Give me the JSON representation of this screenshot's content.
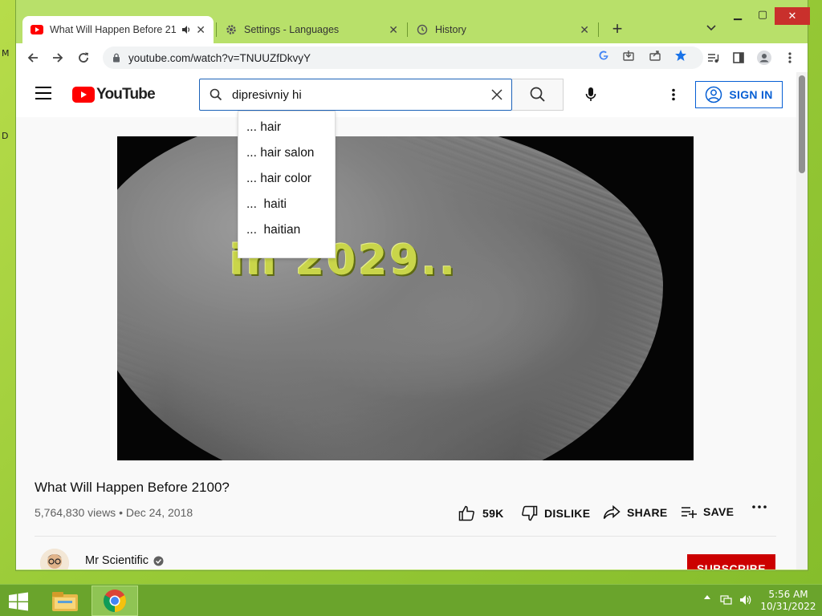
{
  "desktop": {
    "edge_labels": [
      "M",
      "D"
    ]
  },
  "browser": {
    "tabs": [
      {
        "title": "What Will Happen Before 21",
        "active": true,
        "icon": "youtube-icon"
      },
      {
        "title": "Settings - Languages",
        "active": false,
        "icon": "gear-icon"
      },
      {
        "title": "History",
        "active": false,
        "icon": "history-icon"
      }
    ],
    "url": "youtube.com/watch?v=TNUUZfDkvyY"
  },
  "youtube": {
    "logo_text": "YouTube",
    "search": {
      "value": "dipresivniy hi",
      "placeholder": "Search"
    },
    "suggestions": [
      "... hair",
      "... hair salon",
      "... hair color",
      "...  haiti",
      "...  haitian"
    ],
    "sign_in_label": "SIGN IN",
    "video_overlay_text": "in 2029..",
    "video": {
      "title": "What Will Happen Before 2100?",
      "meta": "5,764,830 views • Dec 24, 2018",
      "likes": "59K",
      "dislike_label": "DISLIKE",
      "share_label": "SHARE",
      "save_label": "SAVE"
    },
    "channel": {
      "name": "Mr Scientific",
      "subscribe_label": "SUBSCRIBE"
    }
  },
  "taskbar": {
    "time": "5:56 AM",
    "date": "10/31/2022"
  },
  "colors": {
    "youtube_red": "#ff0000",
    "link_blue": "#065fd4",
    "subscribe_red": "#cc0000",
    "desktop_green": "#9acb38"
  }
}
